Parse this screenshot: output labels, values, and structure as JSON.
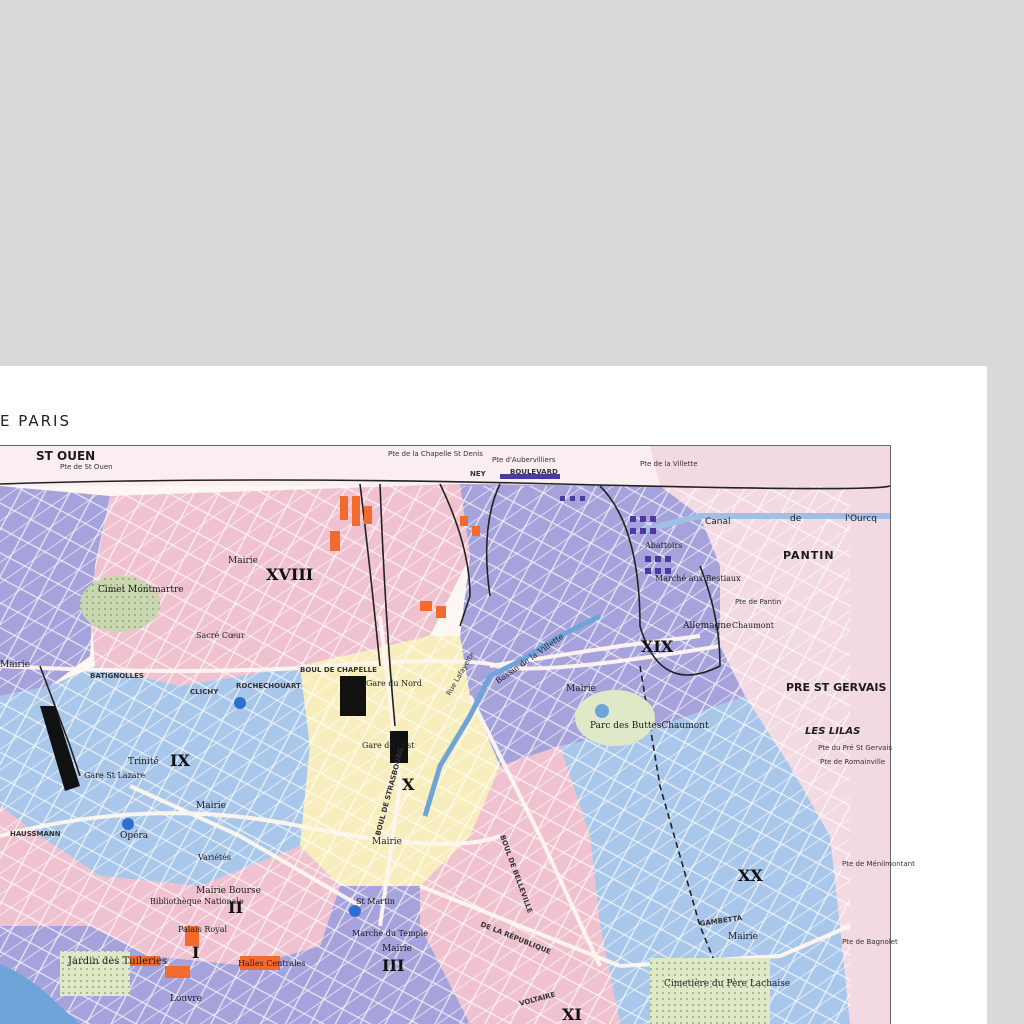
{
  "title": "E PARIS",
  "arrondissements": [
    {
      "id": "xviii",
      "numeral": "XVIII"
    },
    {
      "id": "xix",
      "numeral": "XIX"
    },
    {
      "id": "ix",
      "numeral": "IX"
    },
    {
      "id": "x",
      "numeral": "X"
    },
    {
      "id": "xx",
      "numeral": "XX"
    },
    {
      "id": "ii",
      "numeral": "II"
    },
    {
      "id": "i",
      "numeral": "I"
    },
    {
      "id": "iii",
      "numeral": "III"
    },
    {
      "id": "xi",
      "numeral": "XI"
    }
  ],
  "places": {
    "st_ouen": "ST OUEN",
    "pte_st_ouen": "Pte de St Ouen",
    "pantin": "PANTIN",
    "pre_st_gervais": "PRE ST GERVAIS",
    "les_lilas": "LES LILAS",
    "canal": "Canal",
    "de": "de",
    "lourcq": "l'Ourcq",
    "pte_chapelle": "Pte de la Chapelle St Denis",
    "pte_aubervilliers": "Pte d'Aubervilliers",
    "pte_villette": "Pte de la Villette",
    "pte_pantin": "Pte de Pantin",
    "pte_st_gervais": "Pte du Pré St Gervais",
    "pte_bagnolet": "Pte de Bagnolet",
    "pte_menilmontant": "Pte de Ménilmontant",
    "pte_romainville": "Pte de Romainville",
    "cimet_montmartre": "Cimet Montmartre",
    "sacre_coeur": "Sacré Cœur",
    "mairie_xviii": "Mairie",
    "mairie_xix": "Mairie",
    "mairie_x": "Mairie",
    "mairie_ix": "Mairie",
    "mairie_ii": "Mairie Bourse",
    "mairie_iii": "Mairie",
    "mairie_xx": "Mairie",
    "mairie_batignolles": "Mairie",
    "parc_buttes": "Parc des ButtesChaumont",
    "abattoirs": "Abattoirs",
    "marche_bestiaux": "Marché aux Bestiaux",
    "gare_nord": "Gare du Nord",
    "gare_est": "Gare de l'Est",
    "gare_st_lazare": "Gare St Lazare",
    "trinite": "Trinité",
    "opera": "Opéra",
    "bibliotheque": "Bibliothèque Nationale",
    "palais_royal": "Palais Royal",
    "jardin_tuileries": "Jardin des Tuileries",
    "louvre": "Louvre",
    "halles": "Halles Centrales",
    "marche_temple": "Marché du Temple",
    "cimetiere": "Cimetière du Père Lachaise",
    "allemagne": "Allemagne",
    "chaumont": "Chaumont",
    "bassin_villette": "Bassin de la Villette",
    "boulevard": "BOULEVARD",
    "ney": "NEY",
    "boul_chapelle": "BOUL DE CHAPELLE",
    "boul_clichy": "CLICHY",
    "boul_rochechouart": "ROCHECHOUART",
    "batignolles": "BATIGNOLLES",
    "boul_strasbourg": "BOUL DE STRASBOURG",
    "haussmann": "HAUSSMANN",
    "republique": "DE LA RÉPUBLIQUE",
    "voltaire": "VOLTAIRE",
    "rue_lafayette": "Rue Lafayette",
    "gambetta": "GAMBETTA",
    "belleville": "BOUL DE BELLEVILLE",
    "varietes": "Variétés",
    "st_martin": "St Martin"
  },
  "colors": {
    "background": "#d9d9d9",
    "sheet": "#ffffff",
    "pink": "#f0c2cf",
    "blue": "#a9c7ea",
    "lilac": "#a6a2dc",
    "yellow": "#f8eebd",
    "light_pink": "#f3d9e2",
    "park_green": "#dfe8c7",
    "orange": "#f36a2e"
  }
}
